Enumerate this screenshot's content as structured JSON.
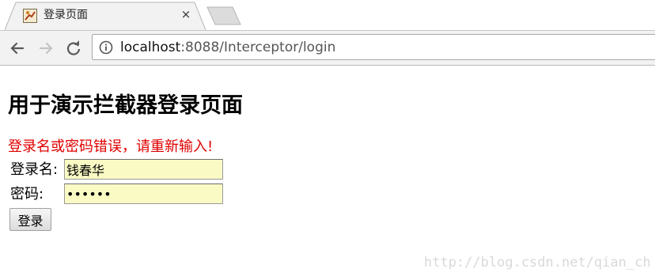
{
  "browser": {
    "tab": {
      "title": "登录页面",
      "close": "×"
    },
    "address_bar": {
      "host": "localhost",
      "rest": ":8088/Interceptor/login"
    }
  },
  "page": {
    "heading": "用于演示拦截器登录页面",
    "error": "登录名或密码错误，请重新输入!",
    "form": {
      "username_label": "登录名:",
      "username_value": "钱春华",
      "password_label": "密码:",
      "password_value": "123456",
      "submit_label": "登录"
    }
  },
  "watermark": "http://blog.csdn.net/qian_ch",
  "colors": {
    "error": "#e00000",
    "autofill": "#fafac4"
  }
}
